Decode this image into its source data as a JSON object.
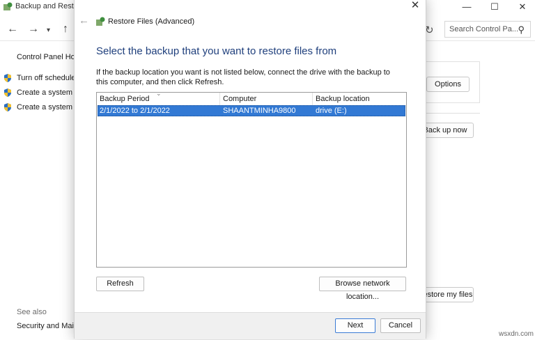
{
  "background_window": {
    "title": "Backup and Restore",
    "search_placeholder": "Search Control Pa...",
    "control_panel_home": "Control Panel Home",
    "side_links": [
      "Turn off schedule",
      "Create a system image",
      "Create a system repair disc"
    ],
    "see_also": "See also",
    "see_also_link": "Security and Maintenance",
    "options_label": "Options",
    "back_up_now_label": "Back up now",
    "restore_my_files_label": "Restore my files"
  },
  "dialog": {
    "title": "Restore Files (Advanced)",
    "heading": "Select the backup that you want to restore files from",
    "description": "If the backup location you want is not listed below, connect the drive with the backup to this computer, and then click Refresh.",
    "columns": [
      "Backup Period",
      "Computer",
      "Backup location"
    ],
    "rows": [
      {
        "period": "2/1/2022 to 2/1/2022",
        "computer": "SHAANTMINHA9800",
        "location": "drive (E:)"
      }
    ],
    "refresh_label": "Refresh",
    "browse_label": "Browse network location...",
    "next_label": "Next",
    "cancel_label": "Cancel"
  },
  "watermark": "wsxdn.com",
  "colors": {
    "heading": "#1f3f7c",
    "selection": "#3279d4",
    "footer": "#f0f0f0"
  }
}
